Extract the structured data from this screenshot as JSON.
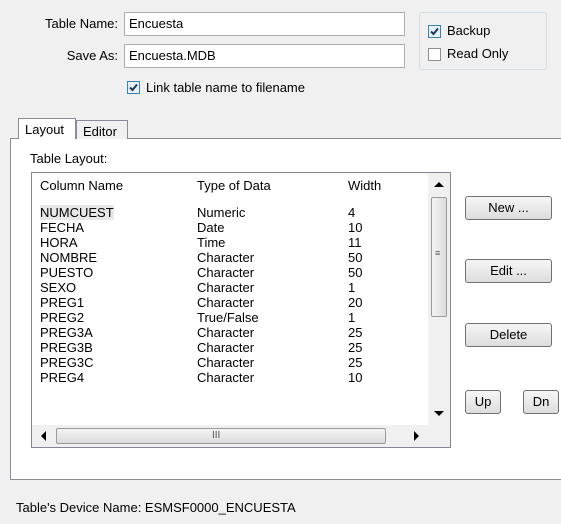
{
  "header": {
    "table_name_label": "Table Name:",
    "table_name_value": "Encuesta",
    "save_as_label": "Save As:",
    "save_as_value": "Encuesta.MDB",
    "link_label": "Link table name to filename",
    "link_checked": true
  },
  "options": {
    "backup_label": "Backup",
    "backup_checked": true,
    "readonly_label": "Read Only",
    "readonly_checked": false
  },
  "tabs": [
    {
      "label": "Layout",
      "active": true
    },
    {
      "label": "Editor",
      "active": false
    }
  ],
  "layout": {
    "group_label": "Table Layout:",
    "columns": [
      "Column Name",
      "Type of Data",
      "Width"
    ],
    "rows": [
      {
        "name": "NUMCUEST",
        "type": "Numeric",
        "width": "4"
      },
      {
        "name": "FECHA",
        "type": "Date",
        "width": "10"
      },
      {
        "name": "HORA",
        "type": "Time",
        "width": "11"
      },
      {
        "name": "NOMBRE",
        "type": "Character",
        "width": "50"
      },
      {
        "name": "PUESTO",
        "type": "Character",
        "width": "50"
      },
      {
        "name": "SEXO",
        "type": "Character",
        "width": "1"
      },
      {
        "name": "PREG1",
        "type": "Character",
        "width": "20"
      },
      {
        "name": "PREG2",
        "type": "True/False",
        "width": "1"
      },
      {
        "name": "PREG3A",
        "type": "Character",
        "width": "25"
      },
      {
        "name": "PREG3B",
        "type": "Character",
        "width": "25"
      },
      {
        "name": "PREG3C",
        "type": "Character",
        "width": "25"
      },
      {
        "name": "PREG4",
        "type": "Character",
        "width": "10"
      }
    ],
    "buttons": {
      "new": "New ...",
      "edit": "Edit ...",
      "delete": "Delete",
      "up": "Up",
      "down": "Dn"
    },
    "hscroll_grip": "III",
    "vscroll_grip": "≡"
  },
  "footer": {
    "device_label": "Table's Device Name: ESMSF0000_ENCUESTA"
  },
  "colors": {
    "window_bg": "#f0f0f0",
    "check_accent": "#3c7fb1",
    "check_mark": "#1e395b"
  },
  "icons": [
    "check-icon",
    "scroll-up-icon",
    "scroll-down-icon",
    "scroll-left-icon",
    "scroll-right-icon"
  ]
}
